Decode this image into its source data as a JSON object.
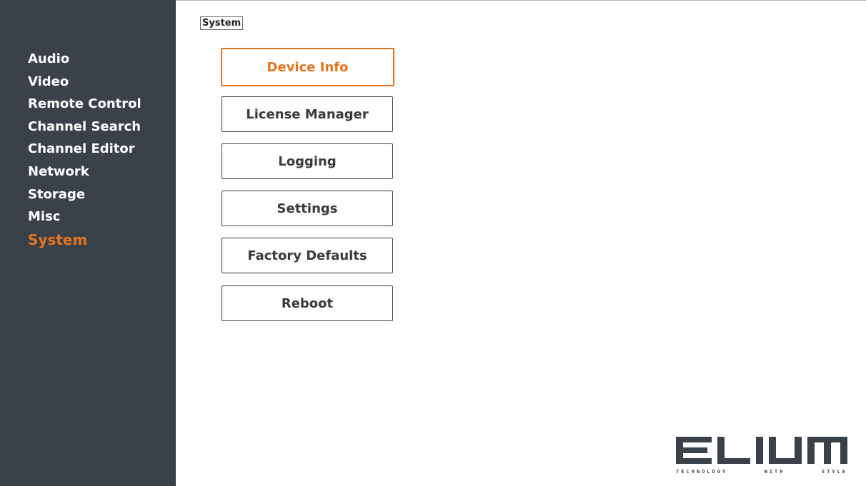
{
  "breadcrumb": "System",
  "sidebar": {
    "items": [
      {
        "label": "Audio",
        "active": false
      },
      {
        "label": "Video",
        "active": false
      },
      {
        "label": "Remote Control",
        "active": false
      },
      {
        "label": "Channel Search",
        "active": false
      },
      {
        "label": "Channel Editor",
        "active": false
      },
      {
        "label": "Network",
        "active": false
      },
      {
        "label": "Storage",
        "active": false
      },
      {
        "label": "Misc",
        "active": false
      },
      {
        "label": "System",
        "active": true
      }
    ]
  },
  "main": {
    "buttons": [
      {
        "label": "Device Info",
        "active": true
      },
      {
        "label": "License Manager",
        "active": false
      },
      {
        "label": "Logging",
        "active": false
      },
      {
        "label": "Settings",
        "active": false
      },
      {
        "label": "Factory Defaults",
        "active": false
      },
      {
        "label": "Reboot",
        "active": false
      }
    ]
  },
  "logo": {
    "wordmark": "ELIUM",
    "tagline": "TECHNOLOGY WITH STYLE"
  },
  "colors": {
    "accent": "#e8731f",
    "sidebar_bg": "#3b4149",
    "sidebar_text": "#ffffff",
    "button_text": "#3a3a3a",
    "button_border": "#3e3e3e"
  }
}
